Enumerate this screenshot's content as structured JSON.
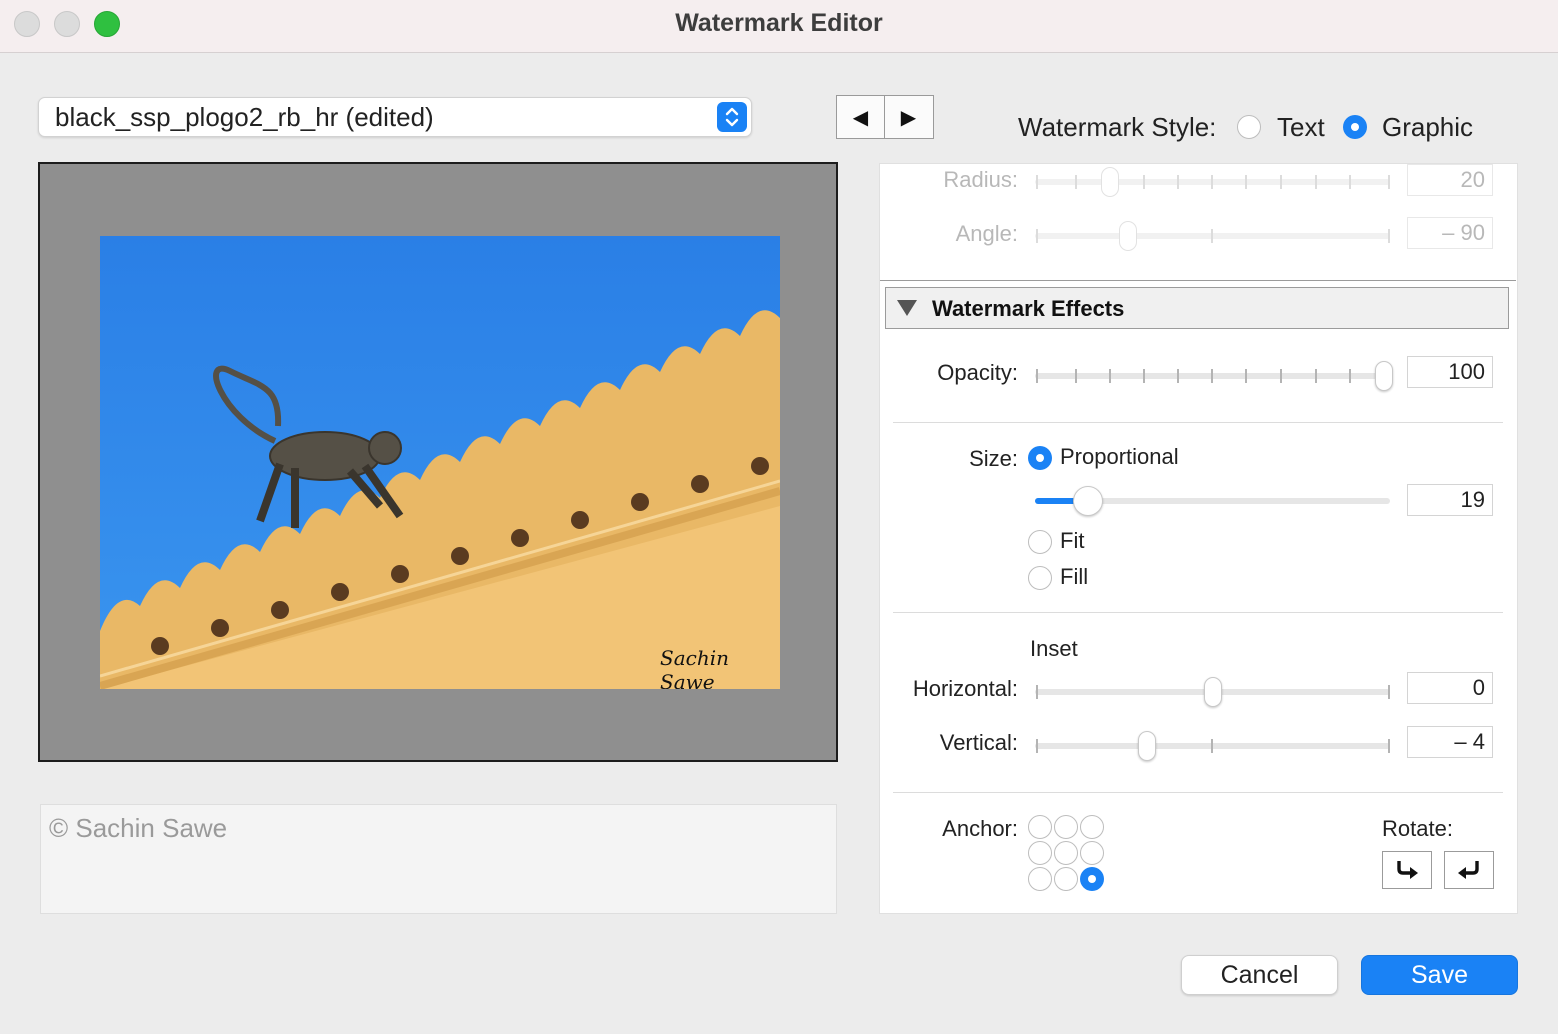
{
  "window": {
    "title": "Watermark Editor"
  },
  "preset": {
    "name": "black_ssp_plogo2_rb_hr (edited)"
  },
  "nav": {
    "prev_symbol": "◀",
    "next_symbol": "▶"
  },
  "watermark_style": {
    "label": "Watermark Style:",
    "options": [
      "Text",
      "Graphic"
    ],
    "selected": "Graphic"
  },
  "preview": {
    "watermark_signature": "Sachin Sawe"
  },
  "caption": {
    "text": "© Sachin Sawe"
  },
  "shadow": {
    "radius_label": "Radius:",
    "radius_value": "20",
    "angle_label": "Angle:",
    "angle_value": "– 90"
  },
  "effects": {
    "section_title": "Watermark Effects",
    "opacity_label": "Opacity:",
    "opacity_value": "100",
    "size_label": "Size:",
    "size_options": [
      "Proportional",
      "Fit",
      "Fill"
    ],
    "size_selected": "Proportional",
    "size_value": "19",
    "inset_label": "Inset",
    "horizontal_label": "Horizontal:",
    "horizontal_value": "0",
    "vertical_label": "Vertical:",
    "vertical_value": "– 4",
    "anchor_label": "Anchor:",
    "anchor_selected": "bottom-right",
    "rotate_label": "Rotate:",
    "rotate_icons": [
      "rotate-clockwise-icon",
      "rotate-counterclockwise-icon"
    ]
  },
  "buttons": {
    "cancel": "Cancel",
    "save": "Save"
  },
  "colors": {
    "accent": "#1a82f5",
    "sky": "#2f86e8",
    "wall": "#f0c070"
  }
}
